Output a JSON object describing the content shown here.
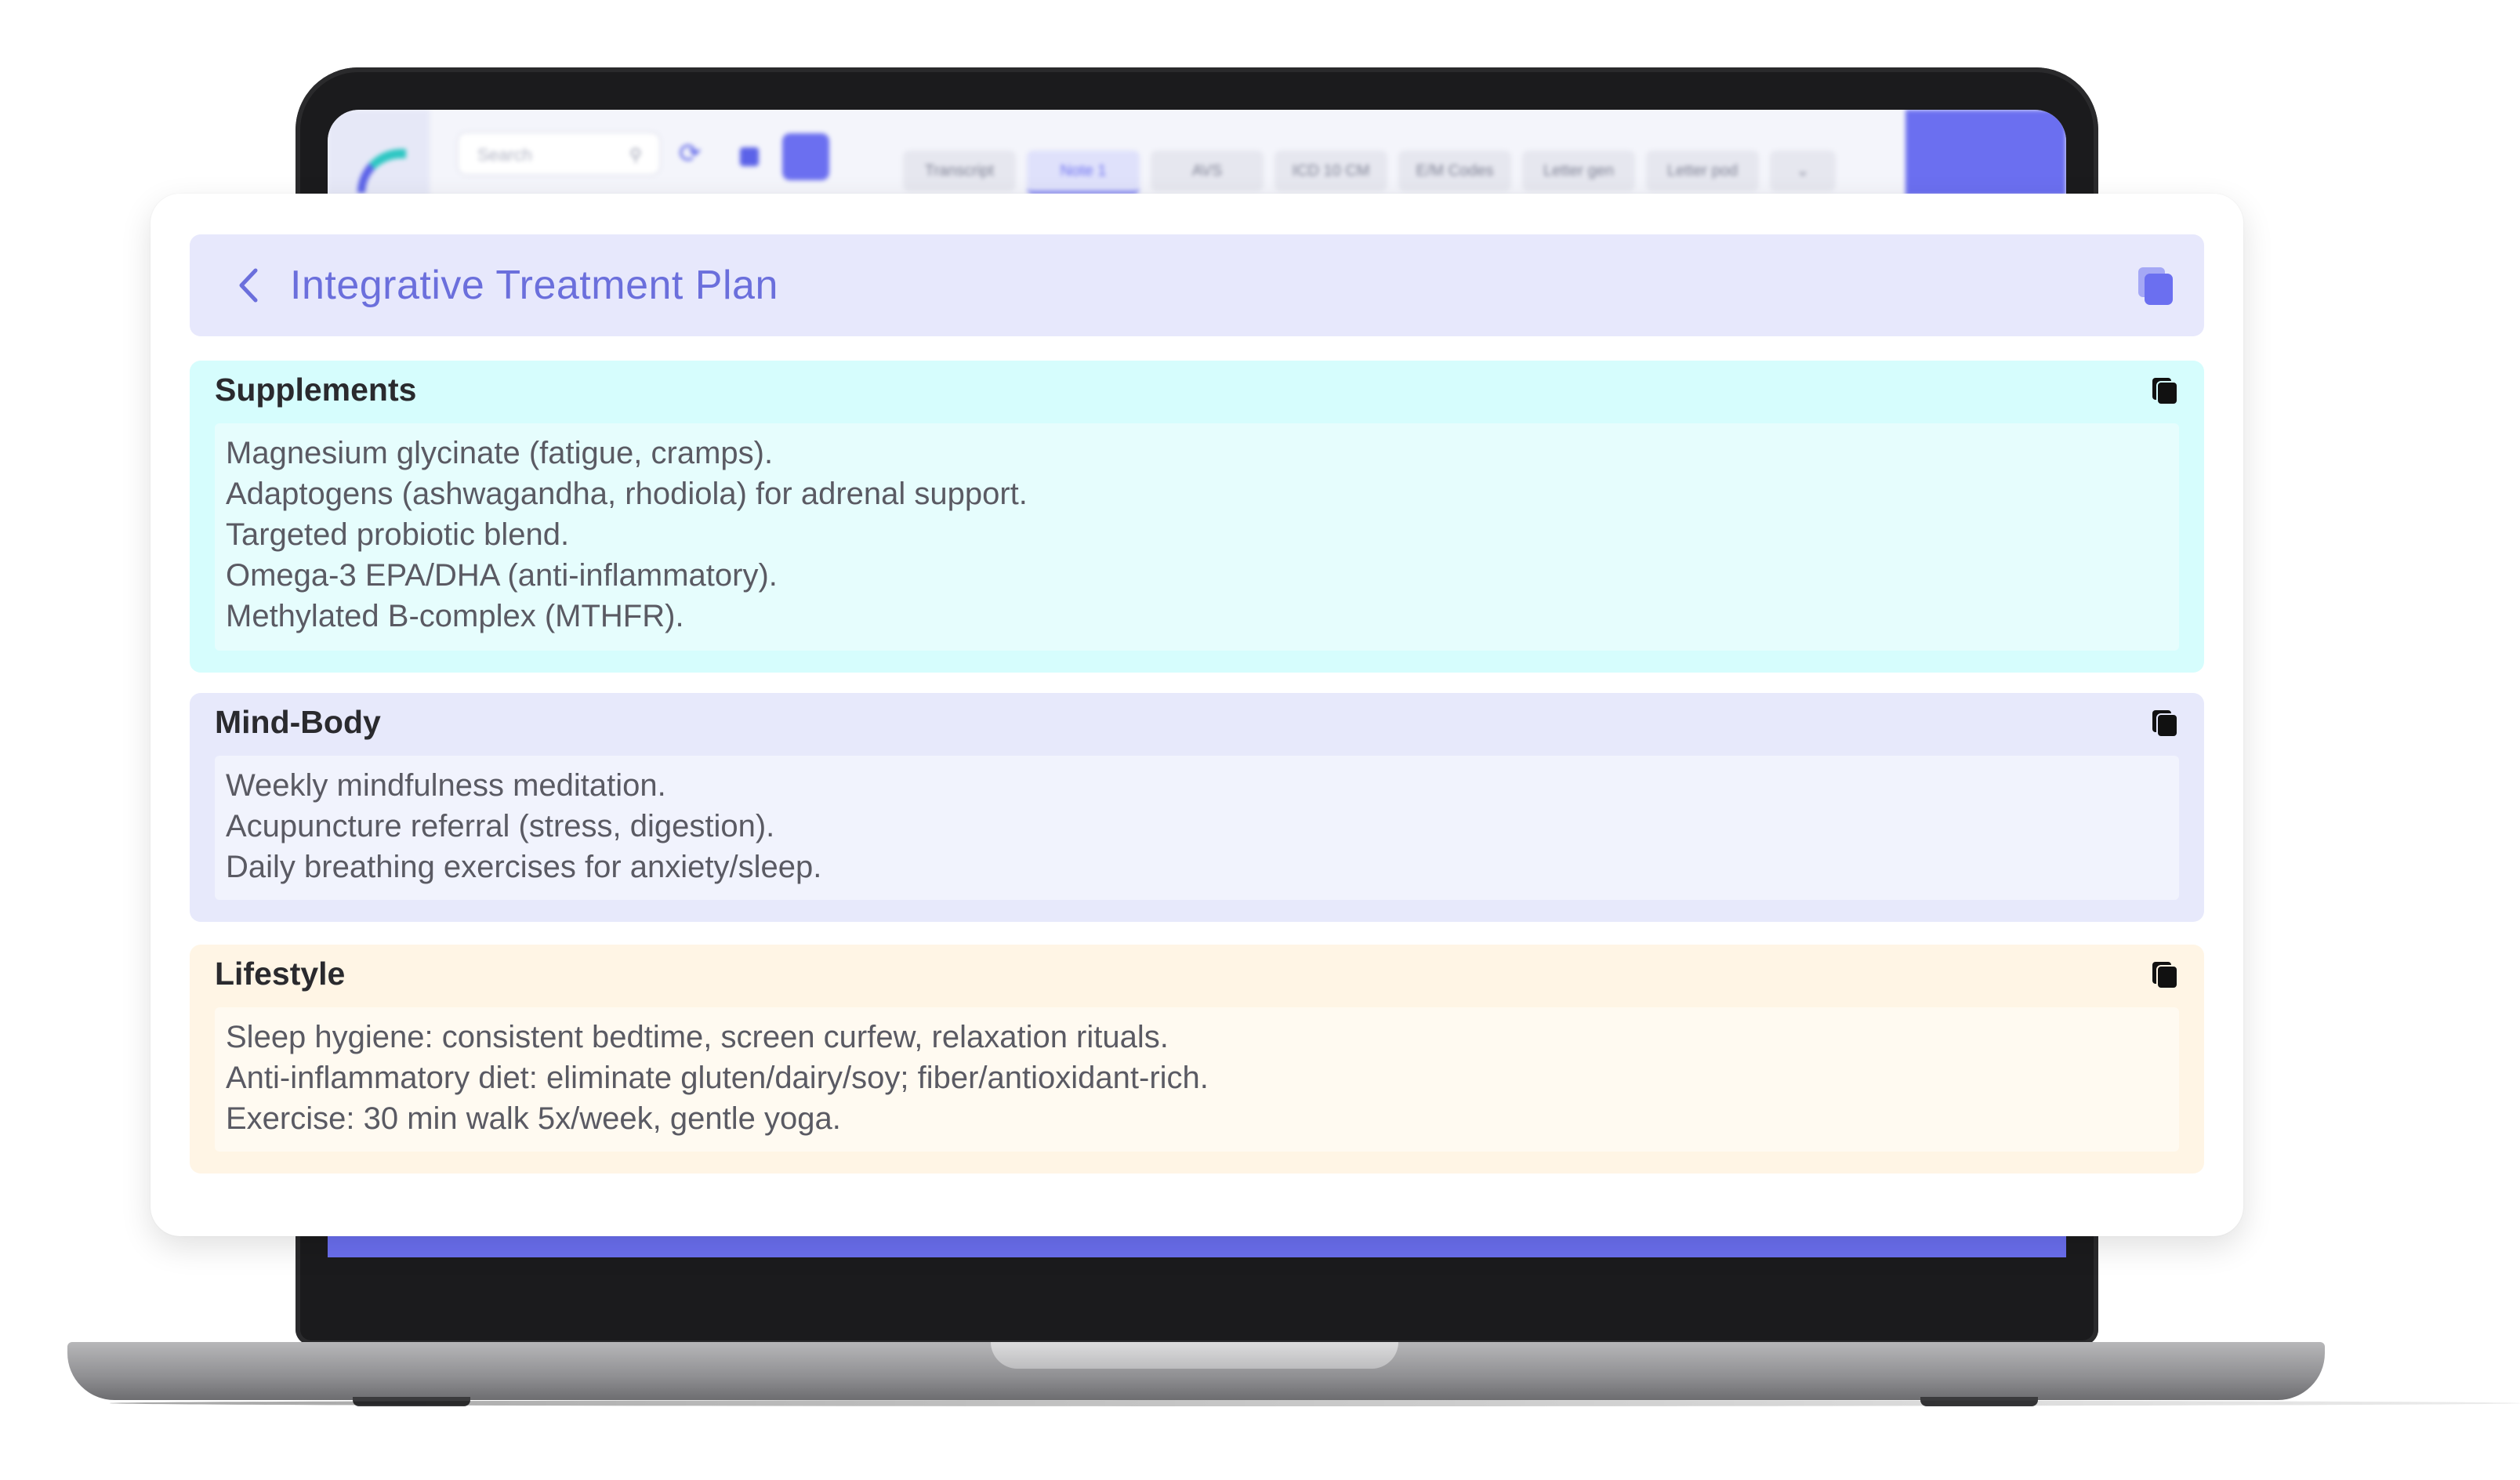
{
  "app": {
    "search_placeholder": "Search",
    "tabs": [
      "Transcript",
      "Note 1",
      "AVS",
      "ICD 10 CM",
      "E/M Codes",
      "Letter gen",
      "Letter pod"
    ]
  },
  "header": {
    "title": "Integrative Treatment Plan"
  },
  "sections": {
    "supplements": {
      "title": "Supplements",
      "lines": [
        "Magnesium glycinate (fatigue, cramps).",
        "Adaptogens (ashwagandha, rhodiola) for adrenal support.",
        "Targeted probiotic blend.",
        "Omega-3 EPA/DHA (anti-inflammatory).",
        "Methylated B-complex (MTHFR)."
      ]
    },
    "mindbody": {
      "title": "Mind-Body",
      "lines": [
        "Weekly mindfulness meditation.",
        "Acupuncture referral (stress, digestion).",
        "Daily breathing exercises for anxiety/sleep."
      ]
    },
    "lifestyle": {
      "title": "Lifestyle",
      "lines": [
        "Sleep hygiene: consistent bedtime, screen curfew, relaxation rituals.",
        "Anti-inflammatory diet: eliminate gluten/dairy/soy; fiber/antioxidant-rich.",
        "Exercise: 30 min walk 5x/week, gentle yoga."
      ]
    }
  },
  "colors": {
    "accent": "#6b6fdc",
    "header_bg": "#e7e8fc",
    "supplements_bg": "#d6fdfd",
    "mindbody_bg": "#e7e9fb",
    "lifestyle_bg": "#fff5e5"
  },
  "icons": {
    "back": "chevron-left-icon",
    "copy": "copy-icon"
  }
}
